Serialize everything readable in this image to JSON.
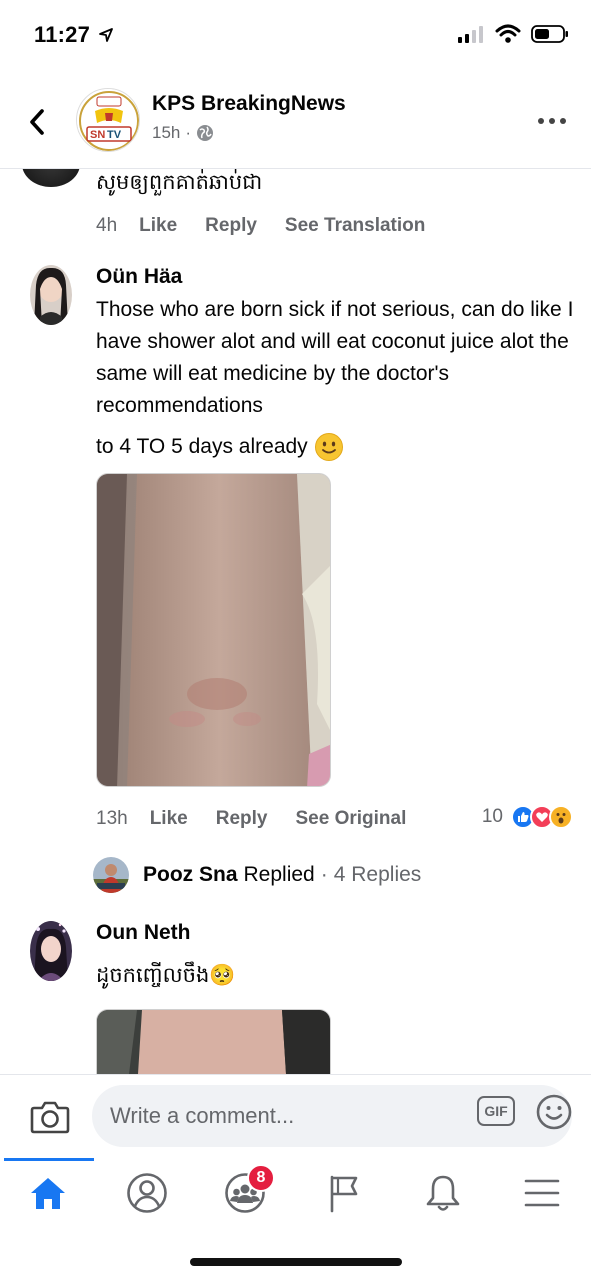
{
  "status_bar": {
    "time": "11:27"
  },
  "header": {
    "page_name": "KPS BreakingNews",
    "post_age": "15h",
    "separator": "·",
    "avatar_text_top": "ព័ត៌មាន",
    "avatar_text_logo": "SNTV"
  },
  "previous_comment": {
    "text": "សូមឲ្យពួកគាត់ឆាប់ជា",
    "time": "4h",
    "like": "Like",
    "reply": "Reply",
    "translate": "See Translation"
  },
  "comment1": {
    "author": "Oün Häa",
    "body": "Those who are born sick if not serious, can do like I have shower alot and will eat coconut juice alot the same will eat medicine by the doctor's recommendations",
    "body_line2": "to 4 TO 5 days already",
    "time": "13h",
    "like": "Like",
    "reply": "Reply",
    "see_original": "See Original",
    "reaction_count": "10",
    "replies": {
      "author": "Pooz Sna",
      "action": "Replied",
      "separator": "·",
      "count": "4 Replies"
    }
  },
  "comment2": {
    "author": "Oun Neth",
    "body": "ដូចកញ្ចើលចឹង🥺"
  },
  "composer": {
    "placeholder": "Write a comment...",
    "gif_label": "GIF"
  },
  "tab_bar": {
    "groups_badge": "8"
  },
  "colors": {
    "accent": "#1877f2",
    "badge": "#e41e3f",
    "muted": "#65676b"
  }
}
